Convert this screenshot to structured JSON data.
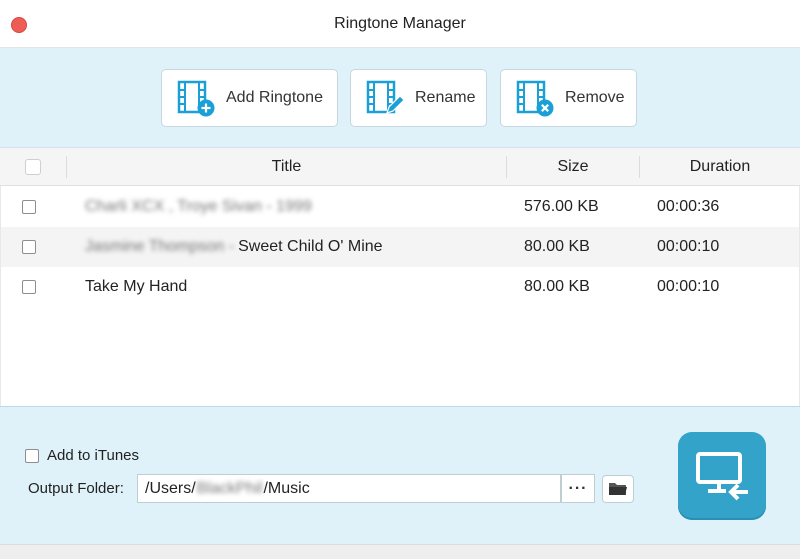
{
  "window": {
    "title": "Ringtone Manager"
  },
  "toolbar": {
    "add_label": "Add Ringtone",
    "rename_label": "Rename",
    "remove_label": "Remove",
    "icons": [
      "film-add-icon",
      "film-edit-icon",
      "film-remove-icon"
    ],
    "accent_color": "#1aa0d6"
  },
  "table": {
    "headers": {
      "title": "Title",
      "size": "Size",
      "duration": "Duration"
    },
    "rows": [
      {
        "title_prefix": "Charli XCX , Troye Sivan - 1999",
        "title": "",
        "size": "576.00 KB",
        "duration": "00:00:36"
      },
      {
        "title_prefix": "Jasmine Thompson - ",
        "title": "Sweet Child O' Mine",
        "size": "80.00 KB",
        "duration": "00:00:10"
      },
      {
        "title_prefix": "",
        "title": "Take My Hand",
        "size": "80.00 KB",
        "duration": "00:00:10"
      }
    ]
  },
  "bottom": {
    "itunes_label": "Add to iTunes",
    "output_label": "Output Folder:",
    "path_prefix": "/Users/",
    "path_user": "BlackPhil",
    "path_suffix": "/Music",
    "more_label": "···",
    "export_color": "#33a3c9"
  }
}
